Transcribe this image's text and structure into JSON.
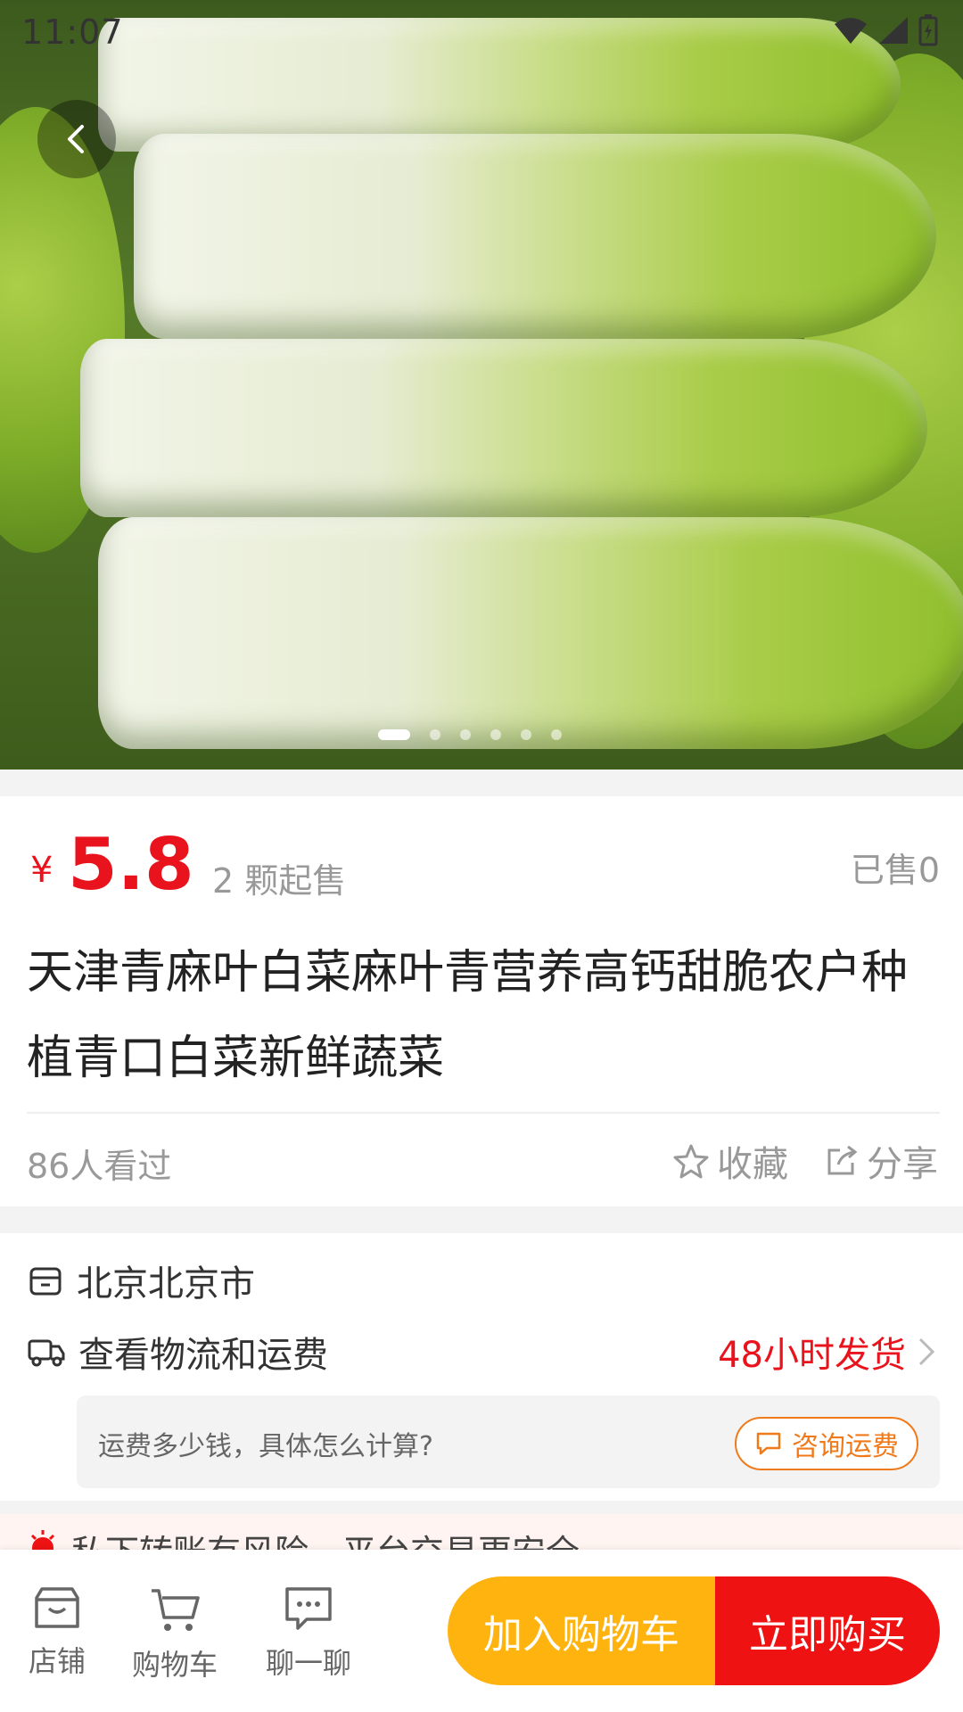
{
  "status_bar": {
    "time": "11:07"
  },
  "carousel": {
    "image_alt": "白菜",
    "total_slides": 6,
    "active_index": 0
  },
  "product": {
    "currency": "¥",
    "price": "5.8",
    "min_sale": "2 颗起售",
    "sold": "已售0",
    "title": "天津青麻叶白菜麻叶青营养高钙甜脆农户种植青口白菜新鲜蔬菜",
    "views": "86人看过",
    "favorite_label": "收藏",
    "share_label": "分享"
  },
  "shipping": {
    "location": "北京北京市",
    "logistics_label": "查看物流和运费",
    "dispatch_time": "48小时发货",
    "faq_question": "运费多少钱，具体怎么计算?",
    "consult_label": "咨询运费"
  },
  "warning": {
    "text": "私下转账有风险，平台交易更安全"
  },
  "bottom_bar": {
    "shop_label": "店铺",
    "cart_label": "购物车",
    "chat_label": "聊一聊",
    "add_to_cart": "加入购物车",
    "buy_now": "立即购买"
  },
  "colors": {
    "price_red": "#e8131c",
    "cart_button": "#ffb30f",
    "buy_button": "#ee1212",
    "consult_orange": "#f07a1a"
  }
}
